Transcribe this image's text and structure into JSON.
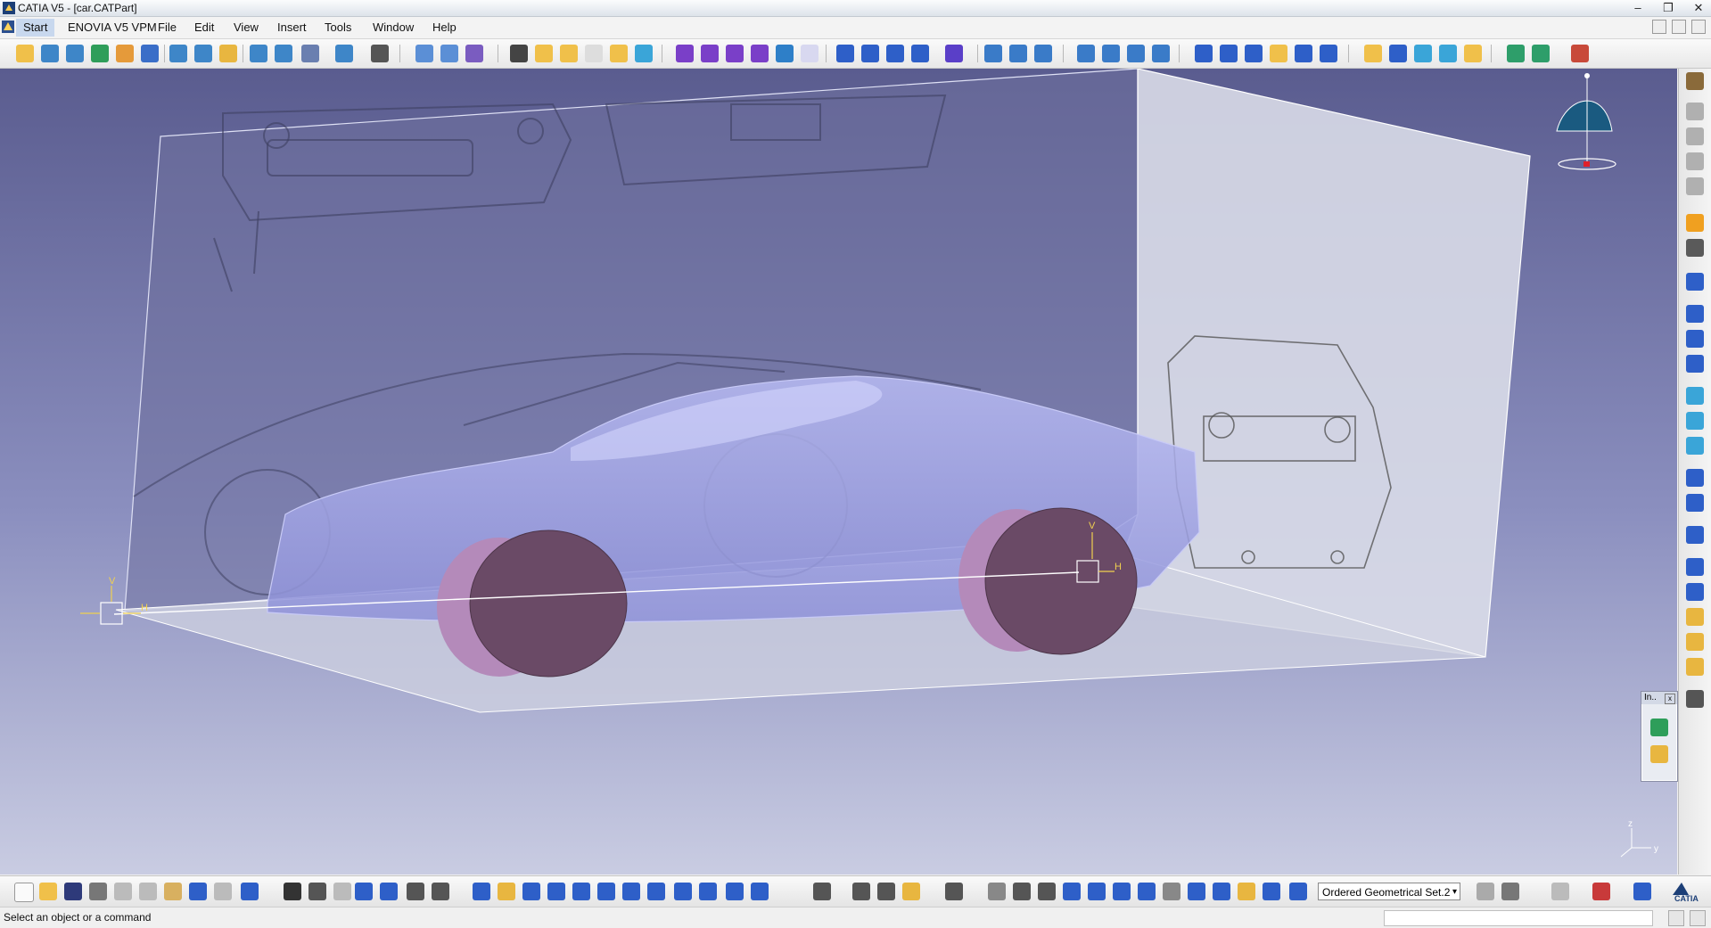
{
  "window": {
    "title": "CATIA V5 - [car.CATPart]",
    "minimize": "–",
    "restore": "❐",
    "close": "✕"
  },
  "menubar": {
    "items": [
      "Start",
      "ENOVIA V5 VPM",
      "File",
      "Edit",
      "View",
      "Insert",
      "Tools",
      "Window",
      "Help"
    ]
  },
  "viewport": {
    "axis_labels": {
      "v": "V",
      "h": "H"
    },
    "compass_axes": {
      "z": "z",
      "y": "y"
    }
  },
  "floating_panel": {
    "title": "In..",
    "close": "x"
  },
  "bottom_toolbar": {
    "geometrical_set_value": "Ordered Geometrical Set.2",
    "geometrical_set_arrow": "▾",
    "catia_logo": "CATIA"
  },
  "status": {
    "text": "Select an object or a command"
  },
  "colors": {
    "viewport_top": "#5a5c8f",
    "viewport_bottom": "#c9cce2",
    "car_body": "#9a9ce6",
    "wheel": "#6a4a66",
    "wheel_side": "#b48aba",
    "compass": "#1a5a80"
  }
}
